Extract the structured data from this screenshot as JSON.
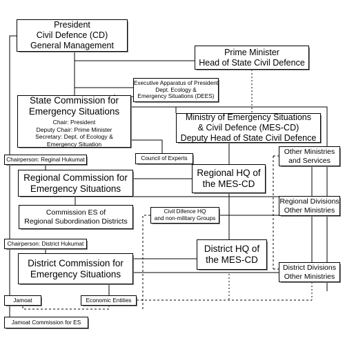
{
  "diagram": {
    "title": "Civil Defence and Emergency Situations Management Structure",
    "line_color": "#000000",
    "box_border_color": "#000000",
    "box_fill_color": "#ffffff",
    "background_color": "#ffffff"
  },
  "nodes": {
    "president": {
      "lines": [
        "President",
        "Civil Defence (CD)",
        "General Management"
      ]
    },
    "prime_minister": {
      "lines": [
        "Prime Minister",
        "Head of State Civil Defence"
      ]
    },
    "dees": {
      "lines": [
        "Executive Apparatus of President",
        "Dept. Ecology &",
        "Emergency Situations (DEES)"
      ]
    },
    "state_commission": {
      "lines": [
        "State Commission for",
        "Emergency Situations"
      ],
      "sublines": [
        "Chair: President",
        "Deputy Chair: Prime Minister",
        "Secretary: Dept. of Ecology &",
        "Emergency Situation"
      ]
    },
    "mes_cd": {
      "lines": [
        "Ministry of Emergency Situations",
        "& Civil Defence (MES-CD)",
        "Deputy Head of State Civil Defence"
      ]
    },
    "chairperson_regional": {
      "lines": [
        "Chairperson: Reginal Hukumat"
      ]
    },
    "council_of_experts": {
      "lines": [
        "Council of Experts"
      ]
    },
    "other_ministries": {
      "lines": [
        "Other Ministries",
        "and Services"
      ]
    },
    "regional_commission": {
      "lines": [
        "Regional Commission for",
        "Emergency Situations"
      ]
    },
    "regional_hq": {
      "lines": [
        "Regional HQ of",
        "the MES-CD"
      ]
    },
    "regional_divisions": {
      "lines": [
        "Regional Divisions",
        "Other Ministries"
      ]
    },
    "commission_es_districts": {
      "lines": [
        "Commission ES of",
        "Regional Subordination Districts"
      ]
    },
    "civil_defence_hq": {
      "lines": [
        "Civil Difence HQ",
        "and non-military Groups"
      ]
    },
    "chairperson_district": {
      "lines": [
        "Chairperson: District Hukumat"
      ]
    },
    "district_commission": {
      "lines": [
        "District Commission for",
        "Emergency Situations"
      ]
    },
    "district_hq": {
      "lines": [
        "District HQ of",
        "the MES-CD"
      ]
    },
    "district_divisions": {
      "lines": [
        "District Divisions",
        "Other Ministries"
      ]
    },
    "jamoat": {
      "lines": [
        "Jamoat"
      ]
    },
    "economic_entities": {
      "lines": [
        "Economic Entities"
      ]
    },
    "jamoat_commission": {
      "lines": [
        "Jamoat Commission for ES"
      ]
    }
  }
}
